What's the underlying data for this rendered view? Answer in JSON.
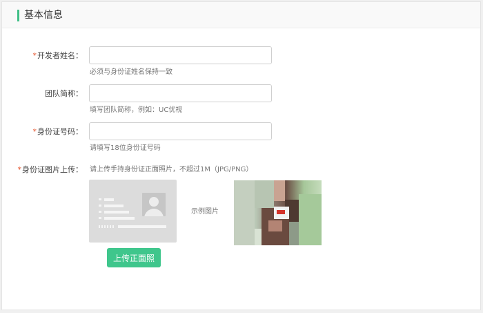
{
  "panel": {
    "title": "基本信息"
  },
  "form": {
    "required_mark": "*",
    "developer_name": {
      "label": "开发者姓名：",
      "value": "",
      "placeholder": "",
      "hint": "必须与身份证姓名保持一致"
    },
    "team_short_name": {
      "label": "团队简称：",
      "value": "",
      "placeholder": "",
      "hint": "填写团队简称，例如：UC优视"
    },
    "id_number": {
      "label": "身份证号码：",
      "value": "",
      "placeholder": "",
      "hint": "请填写18位身份证号码"
    },
    "id_photo": {
      "label": "身份证图片上传：",
      "hint": "请上传手持身份证正面照片，不超过1M（JPG/PNG）",
      "upload_button": "上传正面照",
      "sample_label": "示例图片"
    }
  },
  "icons": {
    "id_card_placeholder": "id-card-icon",
    "sample_image": "sample-photo-image"
  },
  "colors": {
    "accent": "#3fbf86",
    "required": "#e5532c",
    "button": "#3fc68c"
  }
}
